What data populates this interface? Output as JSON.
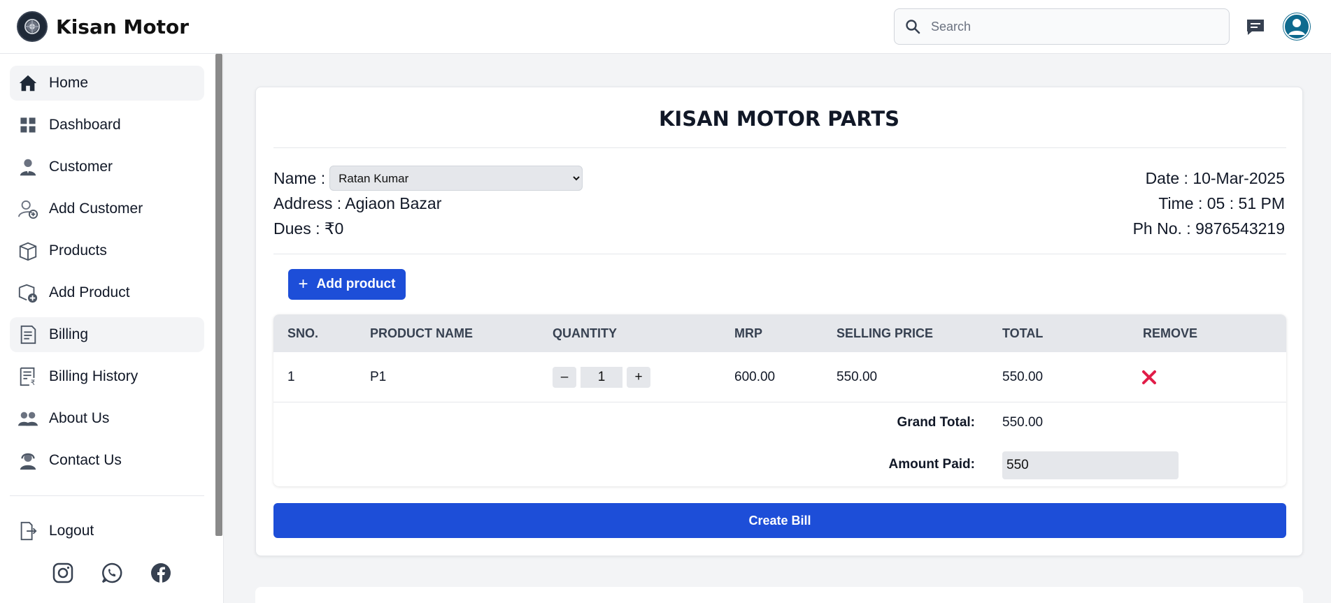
{
  "header": {
    "brand": "Kisan Motor",
    "search_placeholder": "Search"
  },
  "sidebar": {
    "items": [
      {
        "label": "Home",
        "icon": "home-icon"
      },
      {
        "label": "Dashboard",
        "icon": "dashboard-icon"
      },
      {
        "label": "Customer",
        "icon": "customer-icon"
      },
      {
        "label": "Add Customer",
        "icon": "add-customer-icon"
      },
      {
        "label": "Products",
        "icon": "products-icon"
      },
      {
        "label": "Add Product",
        "icon": "add-product-icon"
      },
      {
        "label": "Billing",
        "icon": "billing-icon"
      },
      {
        "label": "Billing History",
        "icon": "billing-history-icon"
      },
      {
        "label": "About Us",
        "icon": "about-us-icon"
      },
      {
        "label": "Contact Us",
        "icon": "contact-us-icon"
      }
    ],
    "logout": "Logout",
    "socials": [
      "instagram-icon",
      "whatsapp-icon",
      "facebook-icon"
    ]
  },
  "bill": {
    "title": "KISAN MOTOR PARTS",
    "name_label": "Name :",
    "name_value": "Ratan Kumar",
    "address": "Address : Agiaon Bazar",
    "dues": "Dues : ₹0",
    "date": "Date : 10-Mar-2025",
    "time": "Time : 05 : 51 PM",
    "phone": "Ph No. : 9876543219",
    "add_product": "Add product",
    "columns": [
      "SNO.",
      "PRODUCT NAME",
      "QUANTITY",
      "MRP",
      "SELLING PRICE",
      "TOTAL",
      "REMOVE"
    ],
    "rows": [
      {
        "sno": "1",
        "product": "P1",
        "quantity": "1",
        "mrp": "600.00",
        "selling": "550.00",
        "total": "550.00"
      }
    ],
    "qty_minus": "–",
    "qty_plus": "+",
    "grand_total_label": "Grand Total:",
    "grand_total": "550.00",
    "amount_paid_label": "Amount Paid:",
    "amount_paid": "550",
    "create_bill": "Create Bill"
  },
  "colors": {
    "primary": "#1d4ed8",
    "remove": "#e11d48"
  }
}
